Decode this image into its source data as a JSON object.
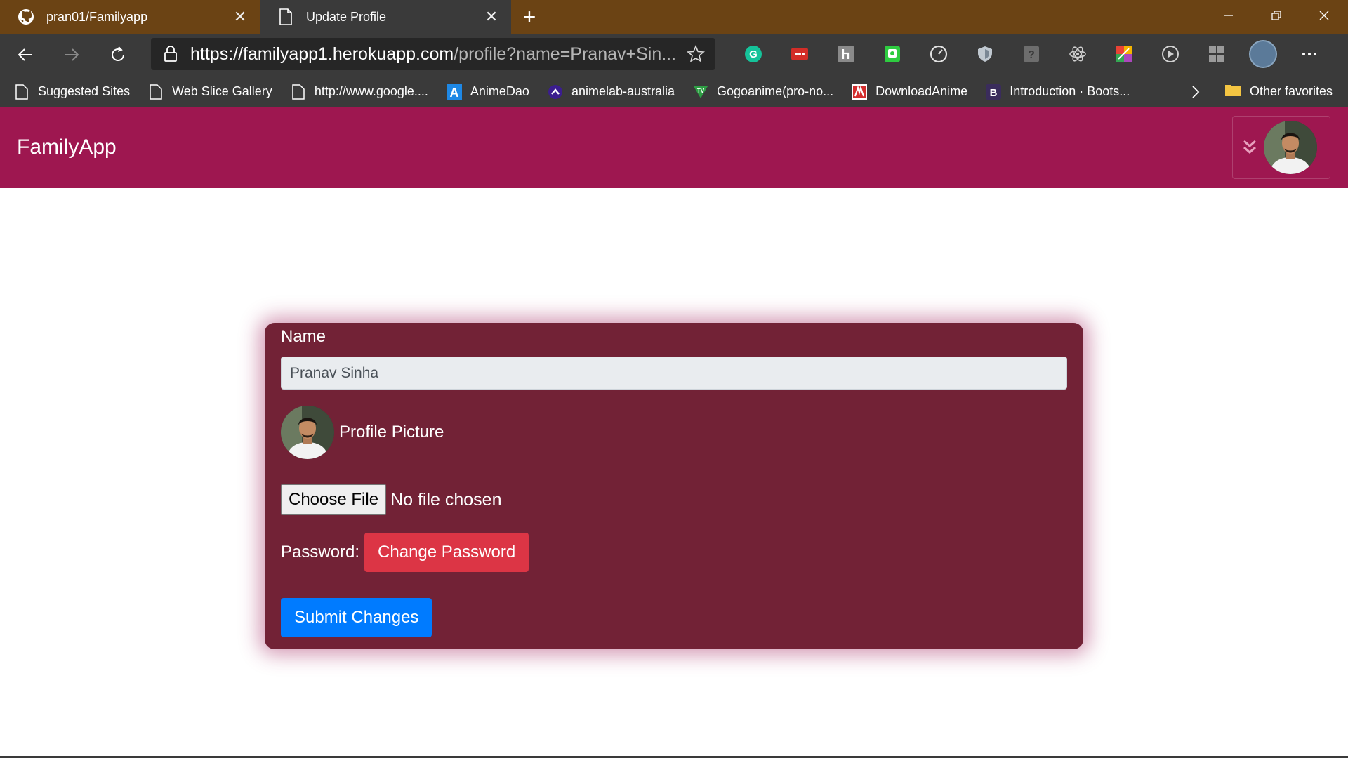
{
  "browser": {
    "tabs": [
      {
        "title": "pran01/Familyapp",
        "icon": "github-icon",
        "active": false
      },
      {
        "title": "Update Profile",
        "icon": "page-icon",
        "active": true
      }
    ],
    "new_tab_glyph": "+",
    "url_host": "https://familyapp1.herokuapp.com",
    "url_path": "/profile?name=Pranav+Sin...",
    "extensions": [
      {
        "name": "grammarly-icon",
        "color": "#15c39a"
      },
      {
        "name": "lastpass-icon",
        "color": "#d32d27"
      },
      {
        "name": "extension-gray-icon",
        "color": "#8a8a8a"
      },
      {
        "name": "extension-green-icon",
        "color": "#2ecc40"
      },
      {
        "name": "speed-icon",
        "color": "#e0e0e0"
      },
      {
        "name": "shield-icon",
        "color": "#c0c8d0"
      },
      {
        "name": "unknown-extension-icon",
        "color": "#6d6d6d"
      },
      {
        "name": "react-devtools-icon",
        "color": "#d0d0d0"
      },
      {
        "name": "colorful-extension-icon",
        "color": "#f4b400"
      },
      {
        "name": "play-icon",
        "color": "#d0d0d0"
      },
      {
        "name": "collections-icon",
        "color": "#9a9a9a"
      }
    ],
    "bookmarks": [
      {
        "label": "Suggested Sites",
        "icon": "page-icon"
      },
      {
        "label": "Web Slice Gallery",
        "icon": "page-icon"
      },
      {
        "label": "http://www.google....",
        "icon": "page-icon"
      },
      {
        "label": "AnimeDao",
        "icon": "animedao-icon"
      },
      {
        "label": "animelab-australia",
        "icon": "animelab-icon"
      },
      {
        "label": "Gogoanime(pro-no...",
        "icon": "gogoanime-icon"
      },
      {
        "label": "DownloadAnime",
        "icon": "downloadanime-icon"
      },
      {
        "label": "Introduction · Boots...",
        "icon": "bootstrap-icon"
      }
    ],
    "other_favorites": "Other favorites"
  },
  "app": {
    "brand": "FamilyApp",
    "colors": {
      "navbar": "#9e1750",
      "card": "#722236",
      "danger": "#dc3545",
      "primary": "#007bff"
    }
  },
  "form": {
    "name_label": "Name",
    "name_value": "Pranav Sinha",
    "picture_label": "Profile Picture",
    "choose_file_label": "Choose File",
    "no_file_text": "No file chosen",
    "password_label": "Password:",
    "change_password_label": "Change Password",
    "submit_label": "Submit Changes"
  }
}
